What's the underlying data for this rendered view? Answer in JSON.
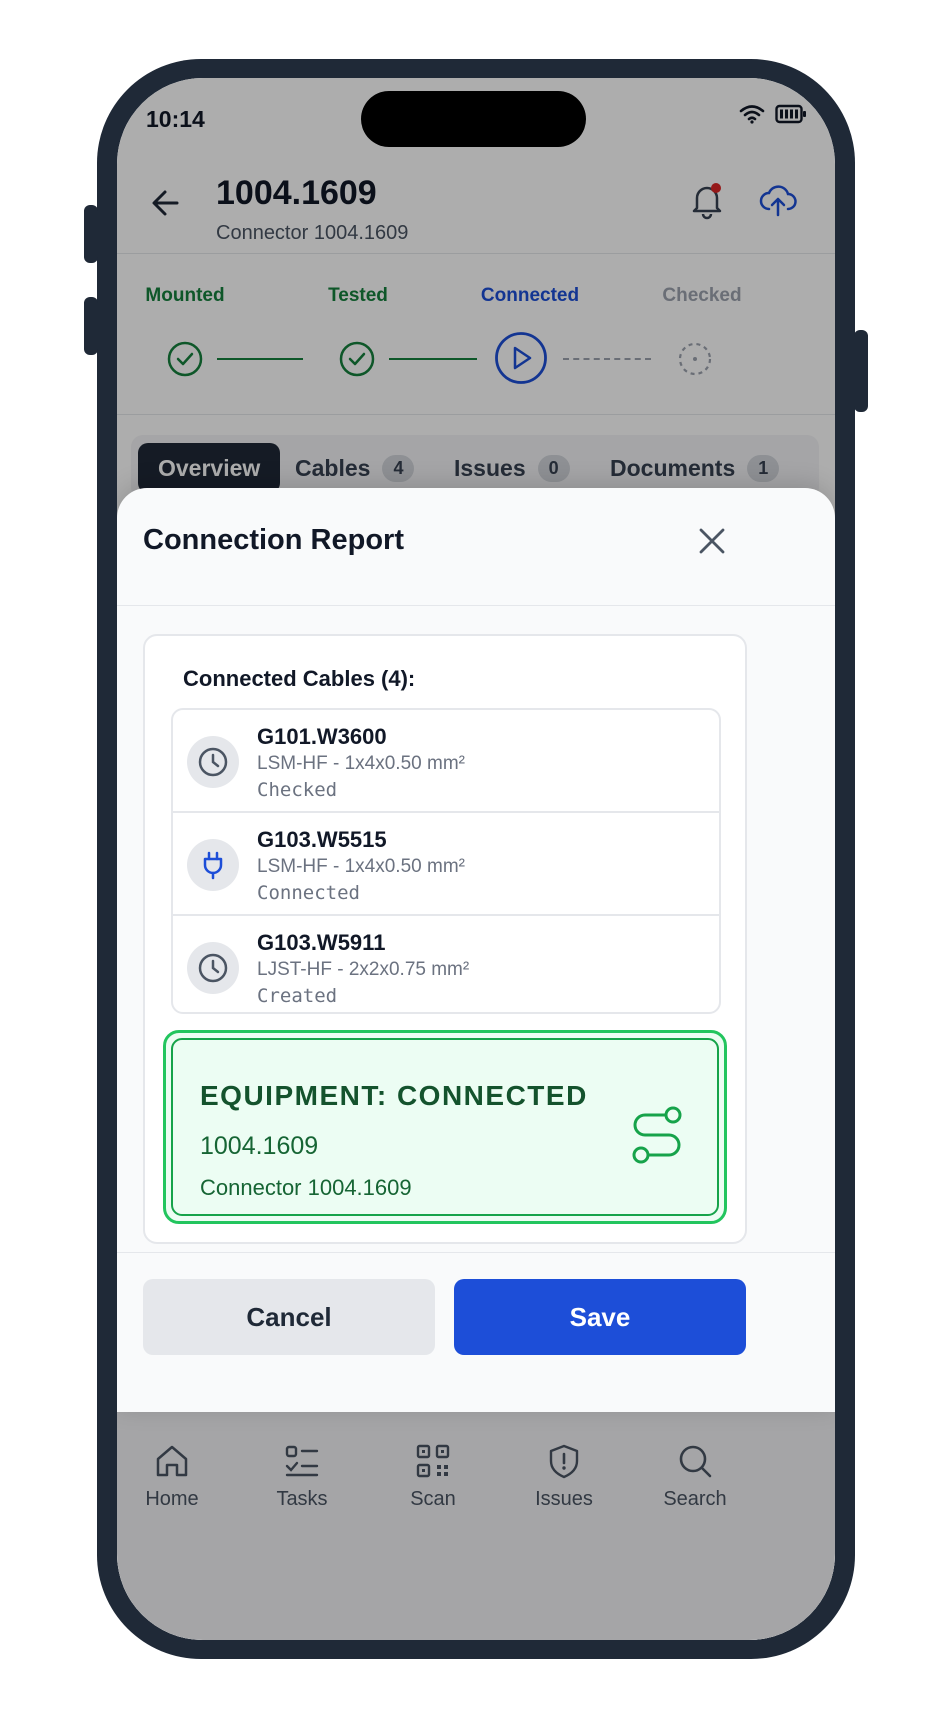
{
  "status_bar": {
    "time": "10:14"
  },
  "header": {
    "title": "1004.1609",
    "subtitle": "Connector 1004.1609"
  },
  "stepper": {
    "steps": [
      {
        "label": "Mounted",
        "state": "done"
      },
      {
        "label": "Tested",
        "state": "done"
      },
      {
        "label": "Connected",
        "state": "current"
      },
      {
        "label": "Checked",
        "state": "pending"
      }
    ]
  },
  "tabs": [
    {
      "label": "Overview",
      "active": true
    },
    {
      "label": "Cables",
      "count": "4"
    },
    {
      "label": "Issues",
      "count": "0"
    },
    {
      "label": "Documents",
      "count": "1"
    }
  ],
  "modal": {
    "title": "Connection Report",
    "cables_heading": "Connected Cables (4):",
    "cables": [
      {
        "name": "G101.W3600",
        "spec": "LSM-HF - 1x4x0.50 mm²",
        "status": "Checked",
        "icon": "clock-icon"
      },
      {
        "name": "G103.W5515",
        "spec": "LSM-HF - 1x4x0.50 mm²",
        "status": "Connected",
        "icon": "plug-icon"
      },
      {
        "name": "G103.W5911",
        "spec": "LJST-HF - 2x2x0.75 mm²",
        "status": "Created",
        "icon": "clock-icon"
      }
    ],
    "equipment": {
      "title": "EQUIPMENT: CONNECTED",
      "id": "1004.1609",
      "name": "Connector 1004.1609",
      "icon": "route-icon"
    },
    "cancel_label": "Cancel",
    "save_label": "Save"
  },
  "bottom_nav": [
    {
      "label": "Home",
      "icon": "home-icon"
    },
    {
      "label": "Tasks",
      "icon": "tasks-icon"
    },
    {
      "label": "Scan",
      "icon": "qr-icon"
    },
    {
      "label": "Issues",
      "icon": "shield-alert-icon"
    },
    {
      "label": "Search",
      "icon": "search-icon"
    }
  ],
  "colors": {
    "green": "#15803d",
    "blue": "#1d4ed8",
    "gray": "#9ca3af",
    "frame": "#1f2937"
  }
}
